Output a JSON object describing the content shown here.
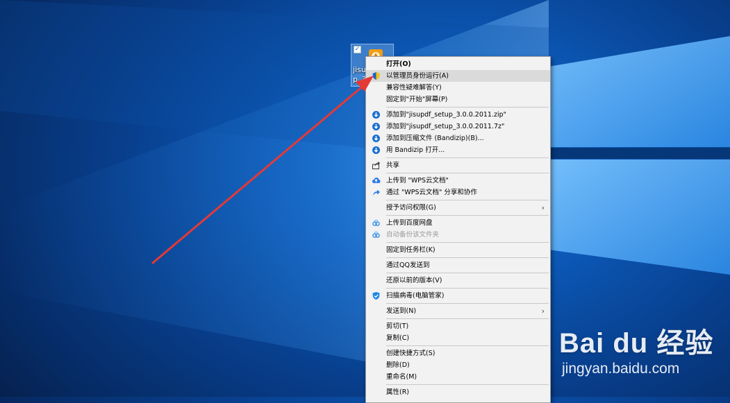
{
  "desktop": {
    "icon_name": "jisu\np_3",
    "colors": {
      "accent": "#0c5ab9",
      "arrow": "#e53935"
    }
  },
  "context_menu": {
    "groups": [
      [
        {
          "id": "open",
          "label": "打开(O)",
          "bold": true,
          "icon": ""
        },
        {
          "id": "run-as-admin",
          "label": "以管理员身份运行(A)",
          "highlighted": true,
          "icon": "shield-icon"
        },
        {
          "id": "compat-troubleshoot",
          "label": "兼容性疑难解答(Y)",
          "icon": ""
        },
        {
          "id": "pin-to-start",
          "label": "固定到\"开始\"屏幕(P)",
          "icon": ""
        }
      ],
      [
        {
          "id": "add-to-zip",
          "label": "添加到\"jisupdf_setup_3.0.0.2011.zip\"",
          "icon": "bandizip-icon"
        },
        {
          "id": "add-to-7z",
          "label": "添加到\"jisupdf_setup_3.0.0.2011.7z\"",
          "icon": "bandizip-icon"
        },
        {
          "id": "add-to-archive",
          "label": "添加到压缩文件 (Bandizip)(B)...",
          "icon": "bandizip-icon"
        },
        {
          "id": "open-with-bandizip",
          "label": "用 Bandizip 打开...",
          "icon": "bandizip-icon"
        }
      ],
      [
        {
          "id": "share",
          "label": "共享",
          "icon": "share-icon"
        }
      ],
      [
        {
          "id": "upload-wps",
          "label": "上传到 \"WPS云文档\"",
          "icon": "cloud-upload-icon"
        },
        {
          "id": "share-wps",
          "label": "通过 \"WPS云文档\" 分享和协作",
          "icon": "share-arrow-icon"
        }
      ],
      [
        {
          "id": "grant-access",
          "label": "授予访问权限(G)",
          "submenu": true,
          "icon": ""
        }
      ],
      [
        {
          "id": "upload-baidu",
          "label": "上传到百度网盘",
          "icon": "baidu-cloud-icon"
        },
        {
          "id": "auto-backup",
          "label": "自动备份该文件夹",
          "disabled": true,
          "icon": "baidu-cloud-icon"
        }
      ],
      [
        {
          "id": "pin-taskbar",
          "label": "固定到任务栏(K)",
          "icon": ""
        }
      ],
      [
        {
          "id": "send-qq",
          "label": "通过QQ发送到",
          "icon": ""
        }
      ],
      [
        {
          "id": "restore-previous",
          "label": "还原以前的版本(V)",
          "icon": ""
        }
      ],
      [
        {
          "id": "scan-virus",
          "label": "扫描病毒(电脑管家)",
          "icon": "tencent-shield-icon"
        }
      ],
      [
        {
          "id": "send-to",
          "label": "发送到(N)",
          "submenu": true,
          "icon": ""
        }
      ],
      [
        {
          "id": "cut",
          "label": "剪切(T)",
          "icon": ""
        },
        {
          "id": "copy",
          "label": "复制(C)",
          "icon": ""
        }
      ],
      [
        {
          "id": "create-shortcut",
          "label": "创建快捷方式(S)",
          "icon": ""
        },
        {
          "id": "delete",
          "label": "删除(D)",
          "icon": ""
        },
        {
          "id": "rename",
          "label": "重命名(M)",
          "icon": ""
        }
      ],
      [
        {
          "id": "properties",
          "label": "属性(R)",
          "icon": ""
        }
      ]
    ]
  },
  "watermark": {
    "logo": "Bai du 经验",
    "url": "jingyan.baidu.com"
  }
}
